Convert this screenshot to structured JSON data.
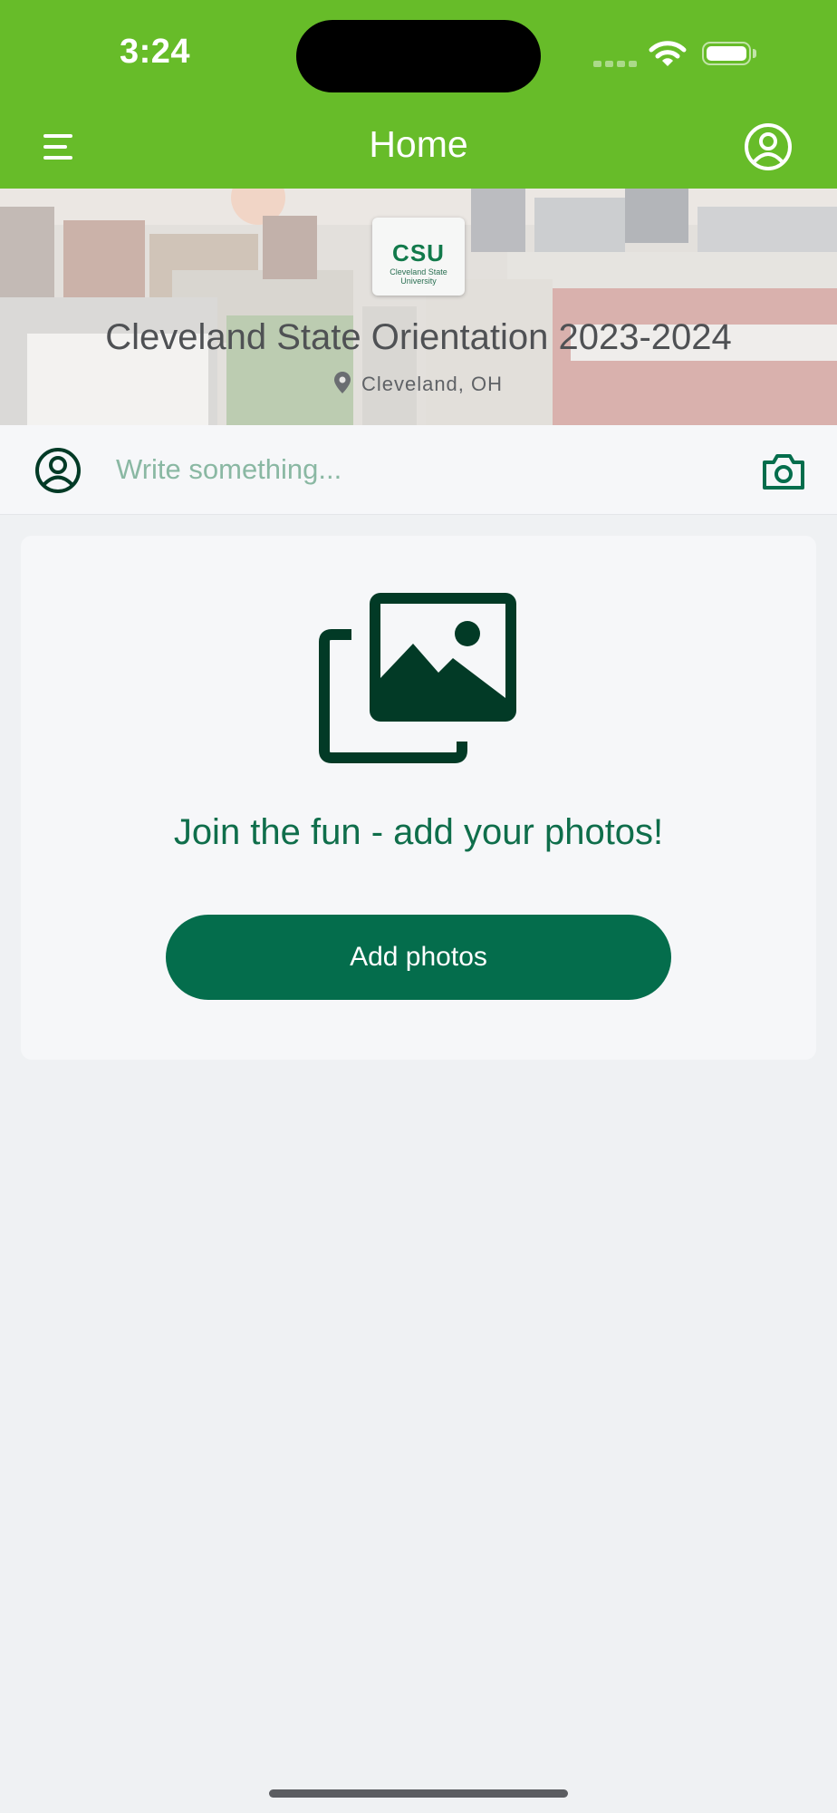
{
  "status_bar": {
    "time": "3:24"
  },
  "header": {
    "title": "Home",
    "menu_icon": "hamburger-menu-icon",
    "profile_icon": "user-circle-icon",
    "background_color": "#67bc29"
  },
  "banner": {
    "logo_mark": "CSU",
    "logo_subtitle": "Cleveland State University",
    "event_title": "Cleveland State Orientation 2023-2024",
    "location": "Cleveland, OH",
    "location_icon": "map-pin-icon"
  },
  "composer": {
    "placeholder": "Write something...",
    "avatar_icon": "user-circle-icon",
    "camera_icon": "camera-icon"
  },
  "empty_state": {
    "icon": "photo-gallery-icon",
    "heading": "Join the fun - add your photos!",
    "button_label": "Add photos"
  },
  "colors": {
    "brand_green": "#67bc29",
    "dark_green": "#046d4c",
    "icon_green": "#023a26",
    "page_background": "#eff1f3"
  }
}
